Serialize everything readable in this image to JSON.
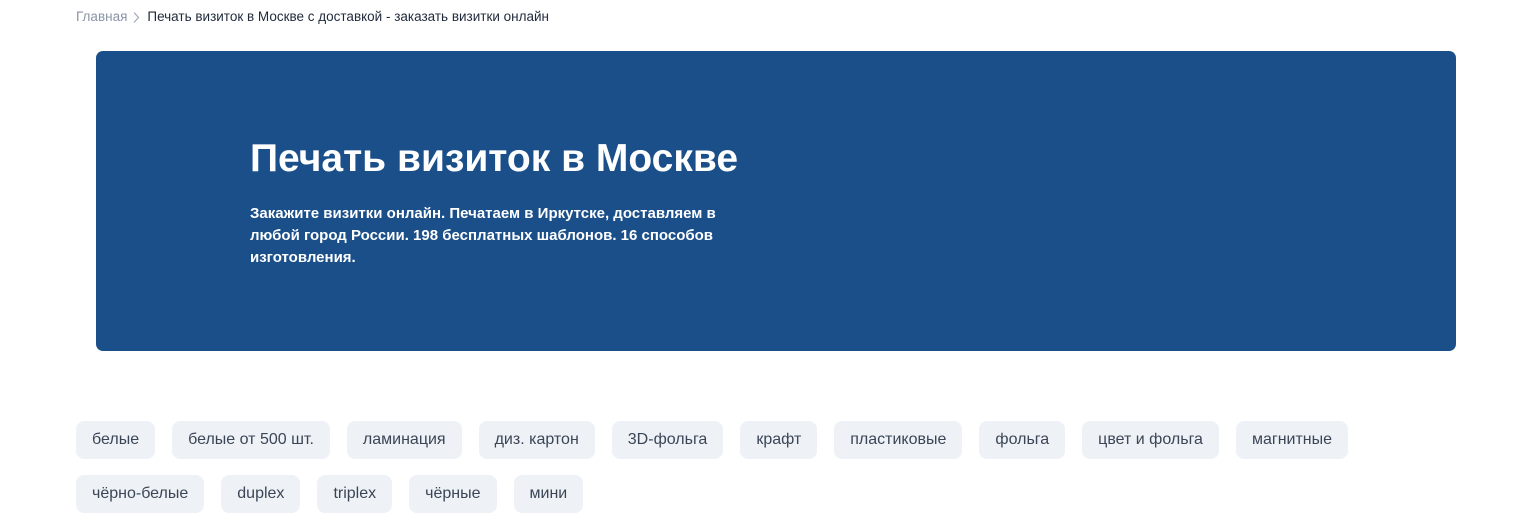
{
  "breadcrumb": {
    "home": "Главная",
    "current": "Печать визиток в Москве с доставкой - заказать визитки онлайн",
    "separator_icon": "chevron-right-icon"
  },
  "hero": {
    "title": "Печать визиток в Москве",
    "description": "Закажите визитки онлайн. Печатаем в Иркутске, доставляем в любой город России. 198 бесплатных шаблонов. 16 способов изготовления."
  },
  "tags": {
    "row1": [
      "белые",
      "белые от 500 шт.",
      "ламинация",
      "диз. картон",
      "3D-фольга",
      "крафт",
      "пластиковые",
      "фольга",
      "цвет и фольга",
      "магнитные"
    ],
    "row2": [
      "чёрно-белые",
      "duplex",
      "triplex",
      "чёрные",
      "мини"
    ]
  },
  "colors": {
    "hero_background": "#1b4f8a",
    "tag_background": "#eef2f6",
    "breadcrumb_link": "#8a94a6"
  }
}
